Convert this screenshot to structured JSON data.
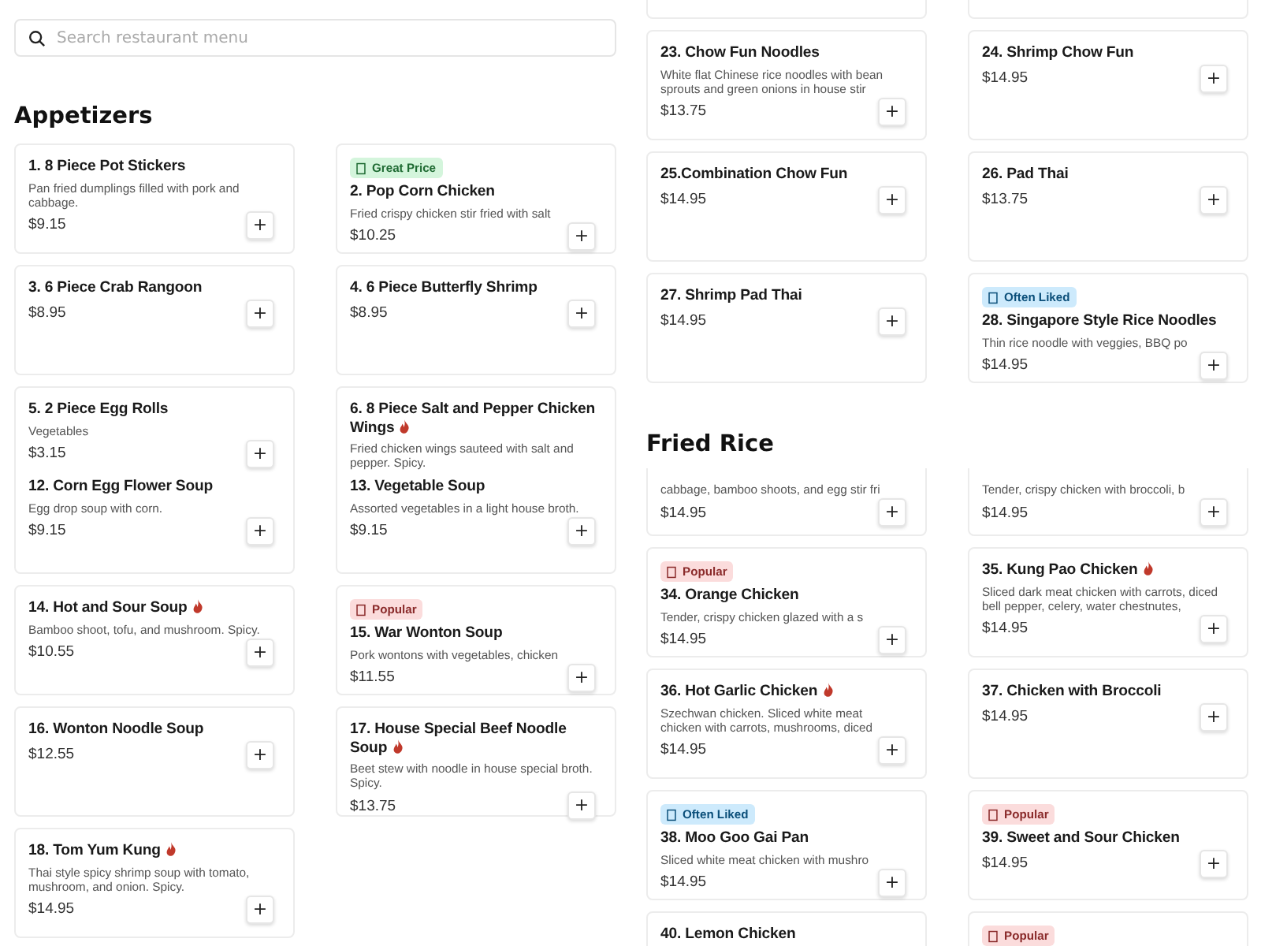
{
  "search": {
    "placeholder": "Search restaurant menu"
  },
  "panels": [
    {
      "blocks": [
        {
          "kind": "heading",
          "text": "Appetizers"
        },
        {
          "kind": "cards",
          "items": [
            {
              "name": "1. 8 Piece Pot Stickers",
              "spicy": false,
              "description": "Pan fried dumplings filled with pork and cabbage.",
              "price": "$9.15",
              "button": "+"
            },
            {
              "name": "2. Pop Corn Chicken",
              "spicy": false,
              "badge": {
                "kind": "deal",
                "label": "Great Price"
              },
              "description": "Fried crispy chicken stir fried with salt",
              "price": "$10.25",
              "button": "+"
            },
            {
              "name": "3. 6 Piece Crab Rangoon",
              "spicy": false,
              "price": "$8.95",
              "button": "+"
            },
            {
              "name": "4. 6 Piece Butterfly Shrimp",
              "spicy": false,
              "price": "$8.95",
              "button": "+"
            },
            {
              "name": "5. 2 Piece Egg Rolls",
              "spicy": false,
              "description": "Vegetables",
              "price": "$3.15",
              "button": "+"
            },
            {
              "name": "6. 8 Piece Salt and Pepper Chicken Wings",
              "spicy": true,
              "description": "Fried chicken wings sauteed with salt and pepper. Spicy."
            }
          ]
        }
      ]
    },
    {
      "blocks": [
        {
          "kind": "cards",
          "items": [
            {
              "name": "12. Corn Egg Flower Soup",
              "spicy": false,
              "description": "Egg drop soup with corn.",
              "price": "$9.15",
              "button": "+"
            },
            {
              "name": "13. Vegetable Soup",
              "spicy": false,
              "description": "Assorted vegetables in a light house broth.",
              "price": "$9.15",
              "button": "+"
            },
            {
              "name": "14. Hot and Sour Soup",
              "spicy": true,
              "description": "Bamboo shoot, tofu, and mushroom. Spicy.",
              "price": "$10.55",
              "button": "+"
            },
            {
              "name": "15. War Wonton Soup",
              "spicy": false,
              "badge": {
                "kind": "popular",
                "label": "Popular"
              },
              "description": "Pork wontons with vegetables, chicken",
              "price": "$11.55",
              "button": "+"
            },
            {
              "name": "16. Wonton Noodle Soup",
              "spicy": false,
              "price": "$12.55",
              "button": "+"
            },
            {
              "name": "17. House Special Beef Noodle Soup",
              "spicy": true,
              "description": "Beet stew with noodle in house special broth. Spicy.",
              "price": "$13.75",
              "button": "+"
            },
            {
              "name": "18. Tom Yum Kung",
              "spicy": true,
              "description": "Thai style spicy shrimp soup with tomato, mushroom, and onion. Spicy.",
              "price": "$14.95",
              "button": "+"
            }
          ]
        }
      ]
    },
    {
      "blocks": [
        {
          "kind": "cards",
          "items": [
            {
              "name": "23. Chow Fun Noodles",
              "spicy": false,
              "description": "White flat Chinese rice noodles with bean sprouts and green onions in house stir",
              "price": "$13.75",
              "button": "+"
            },
            {
              "name": "24. Shrimp Chow Fun",
              "spicy": false,
              "price": "$14.95",
              "button": "+"
            },
            {
              "name": "25.Combination Chow Fun",
              "spicy": false,
              "price": "$14.95",
              "button": "+"
            },
            {
              "name": "26. Pad Thai",
              "spicy": false,
              "price": "$13.75",
              "button": "+"
            },
            {
              "name": "27. Shrimp Pad Thai",
              "spicy": false,
              "price": "$14.95",
              "button": "+"
            },
            {
              "name": "28. Singapore Style Rice Noodles",
              "spicy": false,
              "badge": {
                "kind": "liked",
                "label": "Often Liked"
              },
              "description": "Thin rice noodle with veggies, BBQ po",
              "price": "$14.95",
              "button": "+"
            }
          ]
        },
        {
          "kind": "heading",
          "text": "Fried Rice"
        }
      ]
    },
    {
      "blocks": [
        {
          "kind": "cards",
          "items": [
            {
              "description": "cabbage, bamboo shoots, and egg stir fri",
              "price": "$14.95",
              "button": "+"
            },
            {
              "description": "Tender, crispy chicken with broccoli, b",
              "price": "$14.95",
              "button": "+"
            },
            {
              "name": "34. Orange Chicken",
              "spicy": false,
              "badge": {
                "kind": "popular",
                "label": "Popular"
              },
              "description": "Tender, crispy chicken glazed with a s",
              "price": "$14.95",
              "button": "+"
            },
            {
              "name": "35. Kung Pao Chicken",
              "spicy": true,
              "description": "Sliced dark meat chicken with carrots, diced bell pepper, celery, water chestnutes,",
              "price": "$14.95",
              "button": "+"
            },
            {
              "name": "36. Hot Garlic Chicken",
              "spicy": true,
              "description": "Szechwan chicken. Sliced white meat chicken with carrots, mushrooms, diced",
              "price": "$14.95",
              "button": "+"
            },
            {
              "name": "37. Chicken with Broccoli",
              "spicy": false,
              "price": "$14.95",
              "button": "+"
            },
            {
              "name": "38. Moo Goo Gai Pan",
              "spicy": false,
              "badge": {
                "kind": "liked",
                "label": "Often Liked"
              },
              "description": "Sliced white meat chicken with mushro",
              "price": "$14.95",
              "button": "+"
            },
            {
              "name": "39. Sweet and Sour Chicken",
              "spicy": false,
              "badge": {
                "kind": "popular",
                "label": "Popular"
              },
              "price": "$14.95",
              "button": "+"
            },
            {
              "name": "40. Lemon Chicken",
              "spicy": false
            },
            {
              "badge": {
                "kind": "popular",
                "label": "Popular"
              }
            }
          ]
        }
      ]
    }
  ]
}
